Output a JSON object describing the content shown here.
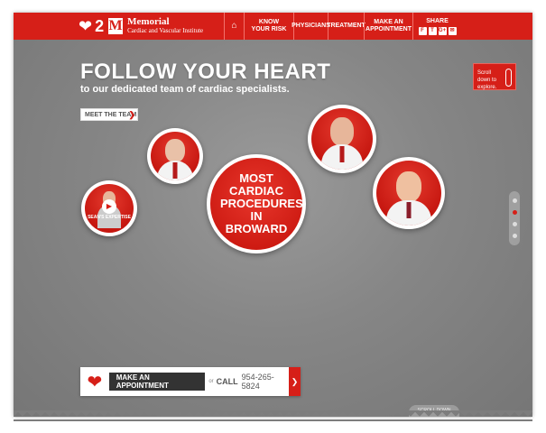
{
  "brand": {
    "number": "2",
    "name": "Memorial",
    "subtitle": "Cardiac and Vascular Institute",
    "color": "#d61f18"
  },
  "nav": {
    "home_icon": "⌂",
    "items": [
      "KNOW YOUR RISK",
      "PHYSICIANS",
      "TREATMENT",
      "MAKE AN APPOINTMENT"
    ],
    "share_label": "SHARE",
    "share_icons": [
      "f",
      "t",
      "g+",
      "✉"
    ]
  },
  "hero": {
    "title": "FOLLOW YOUR HEART",
    "subtitle": "to our dedicated team of cardiac specialists.",
    "meet_button": "MEET THE TEAM"
  },
  "scroll_hint": {
    "text": "Scroll down to explore."
  },
  "bubbles": {
    "center_text": "MOST CARDIAC PROCEDURES IN BROWARD",
    "video_label": "SEAN'S EXPERTISE"
  },
  "cta": {
    "appointment": "MAKE AN APPOINTMENT",
    "or": "or",
    "call": "CALL",
    "phone": "954-265-5824"
  },
  "scroll_down_tab": "SCROLL DOWN"
}
